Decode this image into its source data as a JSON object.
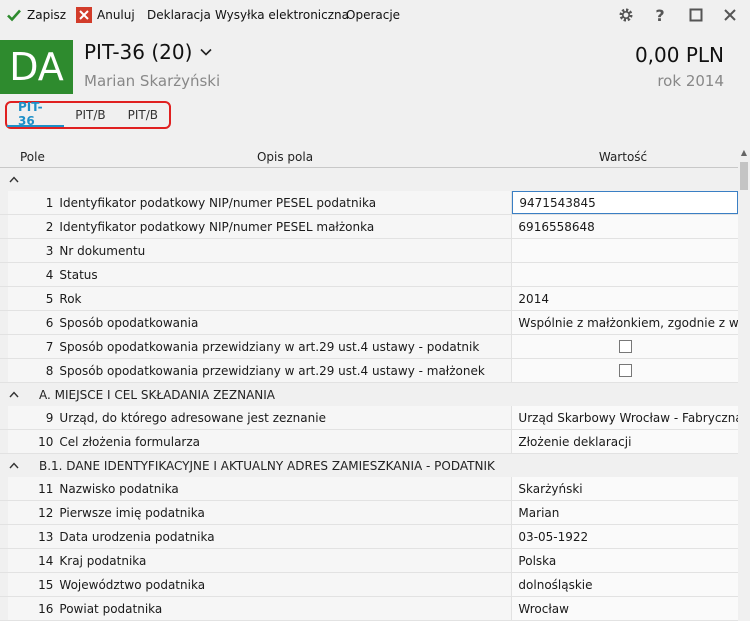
{
  "toolbar": {
    "save_label": "Zapisz",
    "cancel_label": "Anuluj",
    "menu": [
      "Deklaracja",
      "Wysyłka elektroniczna",
      "Operacje"
    ],
    "save_color": "#2e8b2e",
    "cancel_color": "#d23c2a"
  },
  "header": {
    "avatar_text": "DA",
    "avatar_color": "#2e8b2e",
    "title": "PIT-36 (20)",
    "person": "Marian Skarżyński",
    "amount": "0,00 PLN",
    "year": "rok 2014"
  },
  "tabs": [
    {
      "label": "PIT-36",
      "active": true
    },
    {
      "label": "PIT/B",
      "active": false
    },
    {
      "label": "PIT/B",
      "active": false
    }
  ],
  "grid": {
    "headers": {
      "pole": "Pole",
      "opis": "Opis pola",
      "wartosc": "Wartość"
    },
    "sections": [
      {
        "title": "",
        "rows": [
          {
            "num": "1",
            "label": "Identyfikator podatkowy NIP/numer PESEL podatnika",
            "value": "9471543845",
            "type": "edit"
          },
          {
            "num": "2",
            "label": "Identyfikator podatkowy NIP/numer PESEL małżonka",
            "value": "6916558648",
            "type": "text"
          },
          {
            "num": "3",
            "label": "Nr dokumentu",
            "value": "",
            "type": "text"
          },
          {
            "num": "4",
            "label": "Status",
            "value": "",
            "type": "text"
          },
          {
            "num": "5",
            "label": "Rok",
            "value": "2014",
            "type": "text"
          },
          {
            "num": "6",
            "label": "Sposób opodatkowania",
            "value": "Wspólnie z małżonkiem, zgodnie z wni...",
            "type": "text"
          },
          {
            "num": "7",
            "label": "Sposób opodatkowania przewidziany w art.29 ust.4 ustawy - podatnik",
            "value": "",
            "type": "checkbox"
          },
          {
            "num": "8",
            "label": "Sposób opodatkowania przewidziany w art.29 ust.4 ustawy - małżonek",
            "value": "",
            "type": "checkbox"
          }
        ]
      },
      {
        "title": "A. MIEJSCE I CEL SKŁADANIA ZEZNANIA",
        "rows": [
          {
            "num": "9",
            "label": "Urząd, do którego adresowane jest zeznanie",
            "value": "Urząd Skarbowy Wrocław - Fabryczna,...",
            "type": "text"
          },
          {
            "num": "10",
            "label": "Cel złożenia formularza",
            "value": "Złożenie deklaracji",
            "type": "text"
          }
        ]
      },
      {
        "title": "B.1. DANE IDENTYFIKACYJNE I AKTUALNY ADRES ZAMIESZKANIA - PODATNIK",
        "rows": [
          {
            "num": "11",
            "label": "Nazwisko podatnika",
            "value": "Skarżyński",
            "type": "text"
          },
          {
            "num": "12",
            "label": "Pierwsze imię podatnika",
            "value": "Marian",
            "type": "text"
          },
          {
            "num": "13",
            "label": "Data urodzenia podatnika",
            "value": "03-05-1922",
            "type": "text"
          },
          {
            "num": "14",
            "label": "Kraj podatnika",
            "value": "Polska",
            "type": "text"
          },
          {
            "num": "15",
            "label": "Województwo podatnika",
            "value": "dolnośląskie",
            "type": "text"
          },
          {
            "num": "16",
            "label": "Powiat podatnika",
            "value": "Wrocław",
            "type": "text"
          }
        ]
      }
    ]
  }
}
